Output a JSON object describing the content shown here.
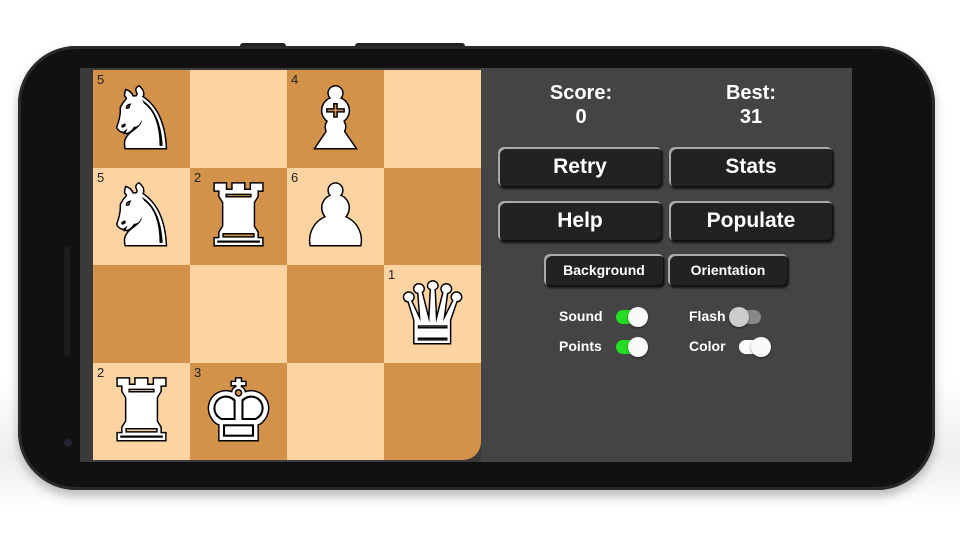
{
  "board": {
    "squares": [
      {
        "piece": "knight",
        "glyph": "♞",
        "number": "5"
      },
      {
        "piece": "",
        "glyph": "",
        "number": ""
      },
      {
        "piece": "bishop",
        "glyph": "♝",
        "number": "4"
      },
      {
        "piece": "",
        "glyph": "",
        "number": ""
      },
      {
        "piece": "knight",
        "glyph": "♞",
        "number": "5"
      },
      {
        "piece": "rook",
        "glyph": "♜",
        "number": "2"
      },
      {
        "piece": "pawn",
        "glyph": "♟",
        "number": "6"
      },
      {
        "piece": "",
        "glyph": "",
        "number": ""
      },
      {
        "piece": "",
        "glyph": "",
        "number": ""
      },
      {
        "piece": "",
        "glyph": "",
        "number": ""
      },
      {
        "piece": "",
        "glyph": "",
        "number": ""
      },
      {
        "piece": "queen",
        "glyph": "♛",
        "number": "1"
      },
      {
        "piece": "rook",
        "glyph": "♜",
        "number": "2"
      },
      {
        "piece": "king",
        "glyph": "♚",
        "number": "3"
      },
      {
        "piece": "",
        "glyph": "",
        "number": ""
      },
      {
        "piece": "",
        "glyph": "",
        "number": ""
      }
    ],
    "colors": {
      "dark": "#d2924a",
      "light": "#fcd3a1"
    }
  },
  "score": {
    "label": "Score:",
    "value": "0"
  },
  "best": {
    "label": "Best:",
    "value": "31"
  },
  "buttons": {
    "retry": "Retry",
    "stats": "Stats",
    "help": "Help",
    "populate": "Populate",
    "background": "Background",
    "orientation": "Orientation"
  },
  "toggles": [
    {
      "label": "Sound",
      "on": true
    },
    {
      "label": "Flash",
      "on": false
    },
    {
      "label": "Points",
      "on": true
    },
    {
      "label": "Color",
      "on": true
    }
  ],
  "colors": {
    "toggle_on": "#22dd22",
    "toggle_color": "#ffffff",
    "toggle_off": "#888888"
  }
}
